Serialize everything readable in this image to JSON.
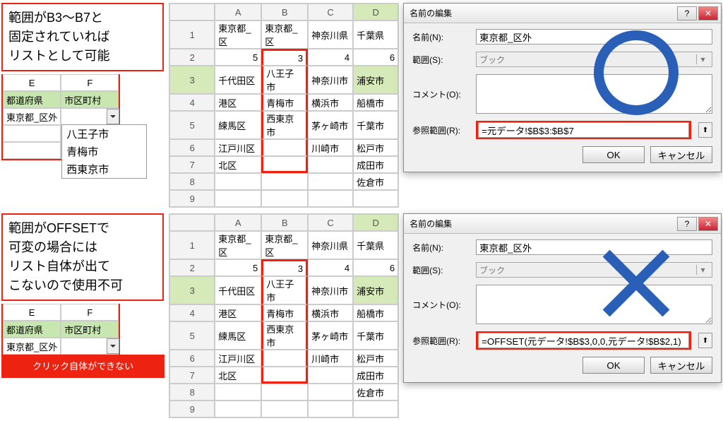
{
  "note1": {
    "l1": "範囲がB3～B7と",
    "l2": "固定されていれば",
    "l3": "リストとして可能"
  },
  "note2": {
    "l1": "範囲がOFFSETで",
    "l2": "可変の場合には",
    "l3": "リスト自体が出て",
    "l4": "こないので使用不可"
  },
  "cannot_click": "クリック自体ができない",
  "mini": {
    "colE": "E",
    "colF": "F",
    "hdrL": "都道府県",
    "hdrR": "市区町村",
    "valL": "東京都_区外",
    "dd": {
      "o1": "八王子市",
      "o2": "青梅市",
      "o3": "西東京市"
    }
  },
  "table": {
    "cols": {
      "A": "A",
      "B": "B",
      "C": "C",
      "D": "D"
    },
    "rows": {
      "1": {
        "A": "東京都_区",
        "B": "東京都_区",
        "C": "神奈川県",
        "D": "千葉県"
      },
      "2": {
        "A": "5",
        "B": "3",
        "C": "4",
        "D": "6"
      },
      "3": {
        "A": "千代田区",
        "B": "八王子市",
        "C": "神奈川市",
        "D": "浦安市"
      },
      "4": {
        "A": "港区",
        "B": "青梅市",
        "C": "横浜市",
        "D": "船橋市"
      },
      "5": {
        "A": "練馬区",
        "B": "西東京市",
        "C": "茅ヶ崎市",
        "D": "千葉市"
      },
      "6": {
        "A": "江戸川区",
        "B": "",
        "C": "川崎市",
        "D": "松戸市"
      },
      "7": {
        "A": "北区",
        "B": "",
        "C": "",
        "D": "成田市"
      },
      "8": {
        "A": "",
        "B": "",
        "C": "",
        "D": "佐倉市"
      },
      "9": {
        "A": "",
        "B": "",
        "C": "",
        "D": ""
      }
    }
  },
  "dlg": {
    "title": "名前の編集",
    "name_label": "名前(N):",
    "name_value": "東京都_区外",
    "scope_label": "範囲(S):",
    "scope_value": "ブック",
    "comment_label": "コメント(O):",
    "ref_label": "参照範囲(R):",
    "ok": "OK",
    "cancel": "キャンセル",
    "ref1": "=元データ!$B$3:$B$7",
    "ref2": "=OFFSET(元データ!$B$3,0,0,元データ!$B$2,1)"
  }
}
